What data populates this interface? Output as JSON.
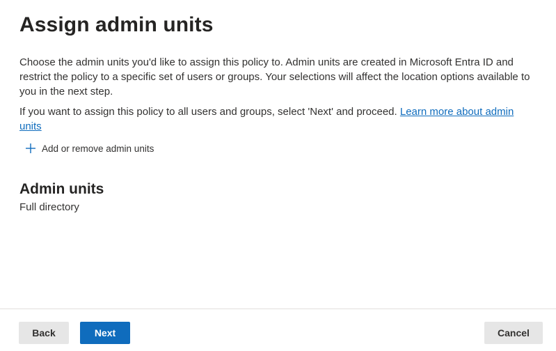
{
  "header": {
    "title": "Assign admin units"
  },
  "description": {
    "paragraph1": "Choose the admin units you'd like to assign this policy to. Admin units are created in Microsoft Entra ID and restrict the policy to a specific set of users or groups. Your selections will affect the location options available to you in the next step.",
    "paragraph2_text": "If you want to assign this policy to all users and groups, select 'Next' and proceed. ",
    "paragraph2_link": "Learn more about admin units"
  },
  "actions": {
    "add_remove_label": "Add or remove admin units",
    "add_icon": "plus-icon"
  },
  "admin_units": {
    "heading": "Admin units",
    "value": "Full directory"
  },
  "footer": {
    "back_label": "Back",
    "next_label": "Next",
    "cancel_label": "Cancel"
  },
  "colors": {
    "accent": "#0f6cbd",
    "secondary_button": "#e6e6e6",
    "text": "#323130"
  }
}
